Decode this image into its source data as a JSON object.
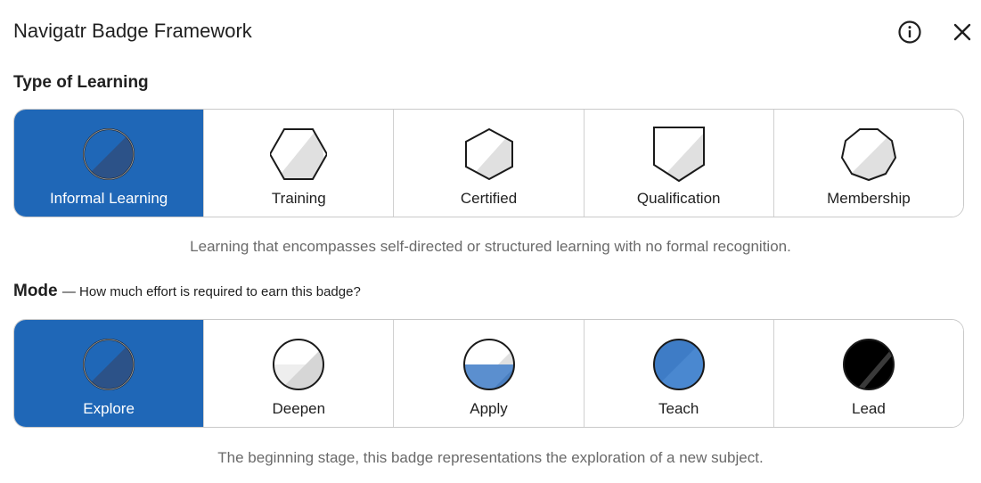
{
  "header": {
    "title": "Navigatr Badge Framework",
    "info_icon": "info-circle-icon",
    "close_icon": "close-icon"
  },
  "learning_type": {
    "title": "Type of Learning",
    "selected": "Informal Learning",
    "options": [
      {
        "label": "Informal Learning",
        "icon": "circle-badge-icon"
      },
      {
        "label": "Training",
        "icon": "hexagon-badge-icon"
      },
      {
        "label": "Certified",
        "icon": "hexagon-vertical-badge-icon"
      },
      {
        "label": "Qualification",
        "icon": "shield-badge-icon"
      },
      {
        "label": "Membership",
        "icon": "octagon-badge-icon"
      }
    ],
    "description": "Learning that encompasses self-directed or structured learning with no formal recognition."
  },
  "mode": {
    "title": "Mode",
    "subtitle": "— How much effort is required to earn this badge?",
    "selected": "Explore",
    "options": [
      {
        "label": "Explore",
        "icon": "explore-circle-icon"
      },
      {
        "label": "Deepen",
        "icon": "deepen-circle-icon"
      },
      {
        "label": "Apply",
        "icon": "apply-circle-icon"
      },
      {
        "label": "Teach",
        "icon": "teach-circle-icon"
      },
      {
        "label": "Lead",
        "icon": "lead-circle-icon"
      }
    ],
    "description": "The beginning stage, this badge representations the exploration of a new subject."
  },
  "colors": {
    "selected_bg": "#1f67b7",
    "selected_shape_fill": "#2c5288",
    "shape_light_fill": "#e0e0e0",
    "apply_blue": "#5b8fcf",
    "teach_blue": "#3e7cc6",
    "lead_black": "#000000"
  }
}
